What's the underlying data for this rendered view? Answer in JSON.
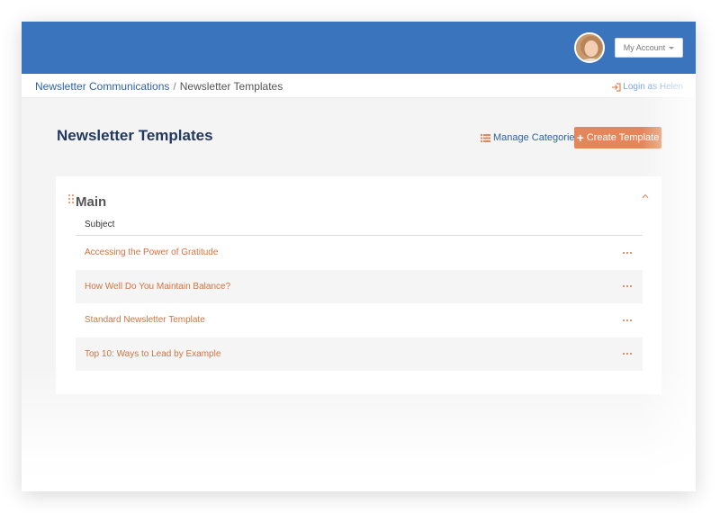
{
  "header": {
    "account_label": "My Account",
    "brand_color": "#3a74bc",
    "accent_color": "#e3865a"
  },
  "breadcrumb": {
    "parent": "Newsletter Communications",
    "separator": "/",
    "current": "Newsletter Templates"
  },
  "login_as": "Login as Helen",
  "page": {
    "title": "Newsletter Templates",
    "manage_label": "Manage Categories",
    "create_label": "Create Template"
  },
  "group": {
    "name": "Main",
    "column_header": "Subject",
    "rows": [
      {
        "subject": "Accessing the Power of Gratitude"
      },
      {
        "subject": "How Well Do You Maintain Balance?"
      },
      {
        "subject": "Standard Newsletter Template"
      },
      {
        "subject": "Top 10: Ways to Lead by Example"
      }
    ]
  },
  "icons": {
    "login": "sign-in-icon",
    "manage": "list-icon",
    "create": "plus-icon",
    "drag": "drag-handle-icon",
    "collapse": "chevron-up-icon",
    "more": "ellipsis-icon",
    "account_caret": "caret-down-icon"
  }
}
